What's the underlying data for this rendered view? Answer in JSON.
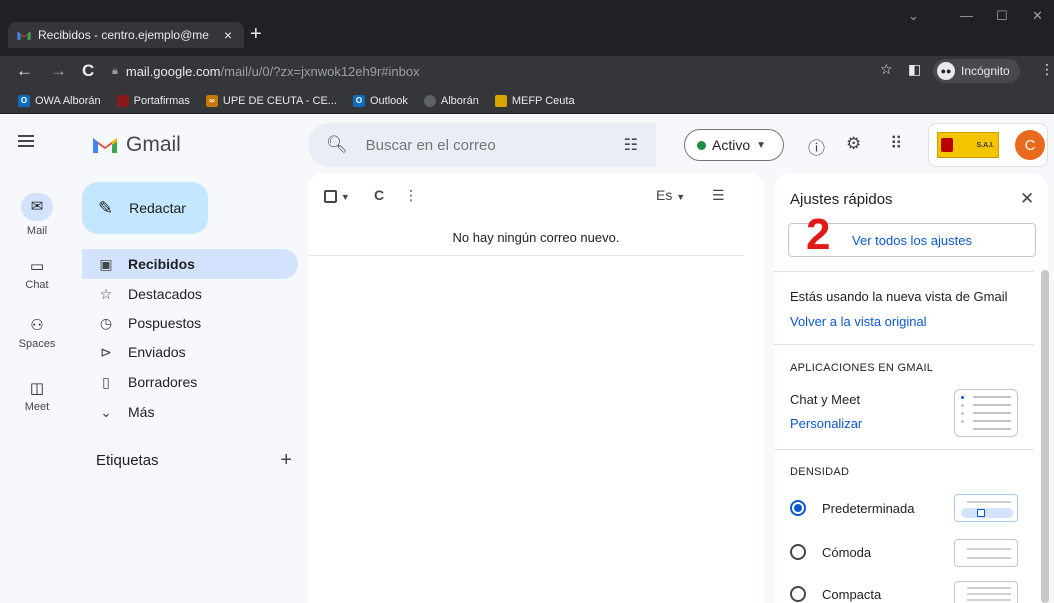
{
  "browser": {
    "tab_title": "Recibidos - centro.ejemplo@me",
    "url_host": "mail.google.com",
    "url_path": "/mail/u/0/?zx=jxnwok12eh9r#inbox",
    "incognito_label": "Incógnito",
    "bookmarks": [
      {
        "label": "OWA Alborán",
        "icon": "outlook-icon",
        "color": "#0f6cbd"
      },
      {
        "label": "Portafirmas",
        "icon": "portafirmas-icon",
        "color": "#8a1a1a"
      },
      {
        "label": "UPE DE CEUTA - CE...",
        "icon": "upe-icon",
        "color": "#c77a00"
      },
      {
        "label": "Outlook",
        "icon": "outlook-icon",
        "color": "#0f6cbd"
      },
      {
        "label": "Alborán",
        "icon": "globe-icon",
        "color": "#5f6368"
      },
      {
        "label": "MEFP Ceuta",
        "icon": "mefp-icon",
        "color": "#d9a400"
      }
    ]
  },
  "gmail": {
    "app_name": "Gmail",
    "search_placeholder": "Buscar en el correo",
    "status_label": "Activo",
    "avatar_letter": "C",
    "org_logo_text": "S.A.I.",
    "rail": [
      {
        "label": "Mail",
        "icon": "mail-icon"
      },
      {
        "label": "Chat",
        "icon": "chat-icon"
      },
      {
        "label": "Spaces",
        "icon": "spaces-icon"
      },
      {
        "label": "Meet",
        "icon": "meet-icon"
      }
    ],
    "compose_label": "Redactar",
    "nav": [
      {
        "label": "Recibidos",
        "icon": "inbox-icon"
      },
      {
        "label": "Destacados",
        "icon": "star-icon"
      },
      {
        "label": "Pospuestos",
        "icon": "clock-icon"
      },
      {
        "label": "Enviados",
        "icon": "send-icon"
      },
      {
        "label": "Borradores",
        "icon": "draft-icon"
      },
      {
        "label": "Más",
        "icon": "chevron-down-icon"
      }
    ],
    "labels_title": "Etiquetas",
    "main": {
      "lang_label": "Es",
      "empty_message": "No hay ningún correo nuevo."
    },
    "quick_settings": {
      "title": "Ajustes rápidos",
      "annotation_number": "2",
      "all_settings_label": "Ver todos los ajustes",
      "new_view_text": "Estás usando la nueva vista de Gmail",
      "revert_link": "Volver a la vista original",
      "apps_caption": "APLICACIONES EN GMAIL",
      "chat_meet_label": "Chat y Meet",
      "customize_link": "Personalizar",
      "density_caption": "DENSIDAD",
      "density_options": [
        {
          "label": "Predeterminada",
          "selected": true
        },
        {
          "label": "Cómoda",
          "selected": false
        },
        {
          "label": "Compacta",
          "selected": false
        }
      ]
    }
  }
}
